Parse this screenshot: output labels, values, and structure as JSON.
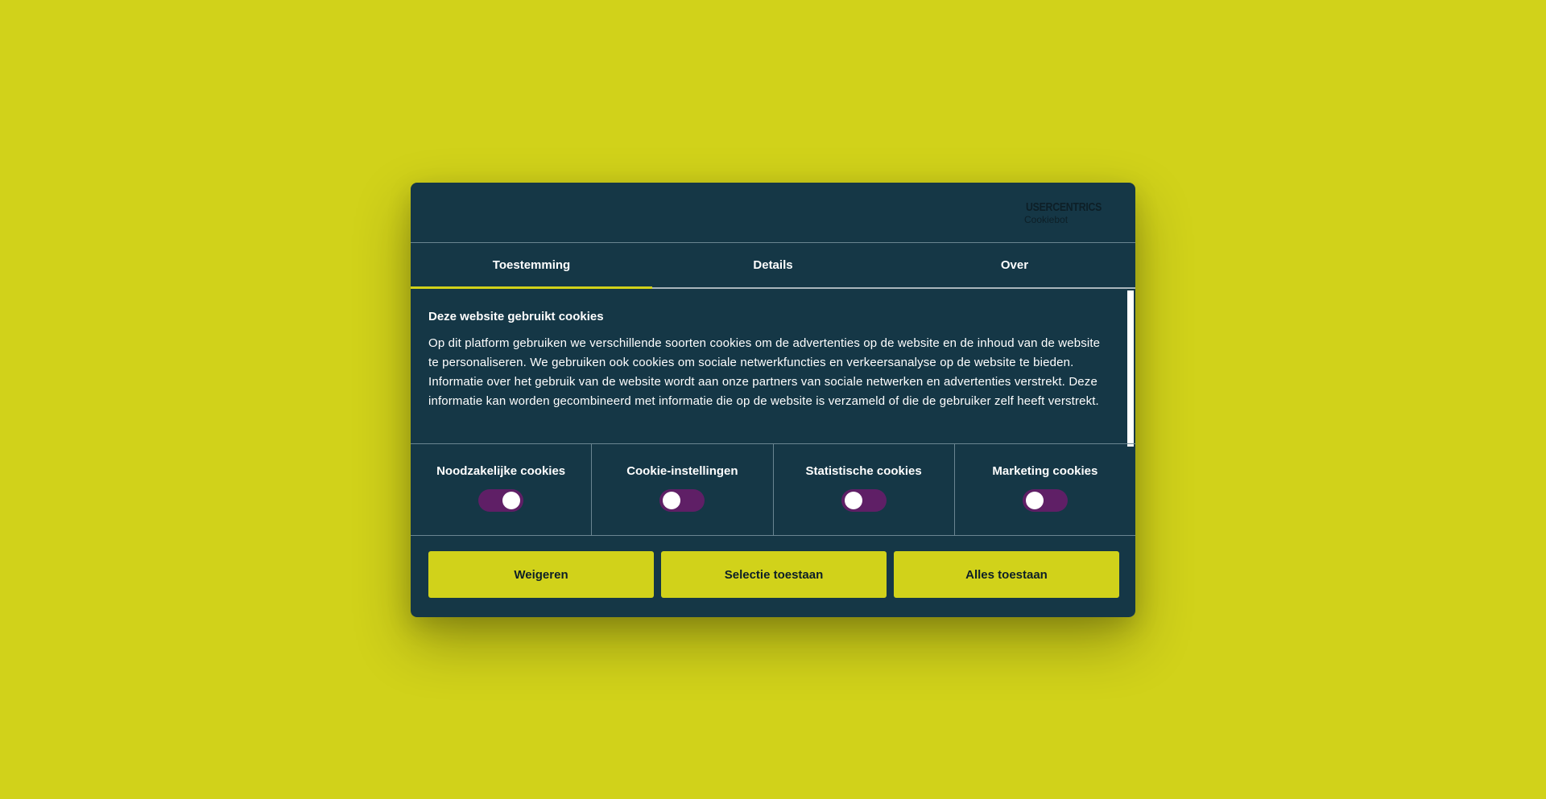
{
  "brand": {
    "logo_word": "USERCENTRICS",
    "logo_sub": "Cookiebot",
    "page_background": "#d1d21a",
    "dialog_background": "#153746",
    "accent": "#d1d21a",
    "toggle_color": "#5f1f66"
  },
  "tabs": [
    {
      "label": "Toestemming",
      "active": true
    },
    {
      "label": "Details",
      "active": false
    },
    {
      "label": "Over",
      "active": false
    }
  ],
  "intro": {
    "title": "Deze website gebruikt cookies",
    "body": "Op dit platform gebruiken we verschillende soorten cookies om de advertenties op de website en de inhoud van de website te personaliseren. We gebruiken ook cookies om sociale netwerkfuncties en verkeersanalyse op de website te bieden. Informatie over het gebruik van de website wordt aan onze partners van sociale netwerken en advertenties verstrekt. Deze informatie kan worden gecombineerd met informatie die op de website is verzameld of die de gebruiker zelf heeft verstrekt."
  },
  "categories": [
    {
      "label": "Noodzakelijke cookies",
      "enabled": true
    },
    {
      "label": "Cookie-instellingen",
      "enabled": false
    },
    {
      "label": "Statistische cookies",
      "enabled": false
    },
    {
      "label": "Marketing cookies",
      "enabled": false
    }
  ],
  "buttons": {
    "deny": "Weigeren",
    "allow_selection": "Selectie toestaan",
    "allow_all": "Alles toestaan"
  }
}
